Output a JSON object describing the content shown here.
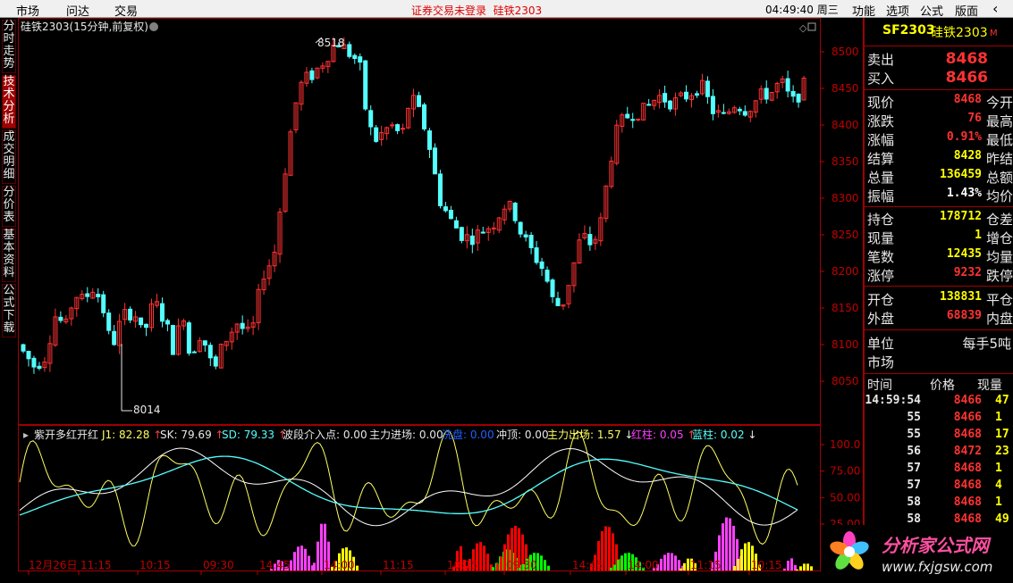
{
  "topbar": {
    "menus": [
      "市场",
      "问达",
      "交易"
    ],
    "notice": "证券交易未登录",
    "symbol": "硅铁2303",
    "time": "04:49:40",
    "weekday": "周三",
    "right_menus": [
      "功能",
      "选项",
      "公式",
      "版面"
    ],
    "back": "‹"
  },
  "left_tabs": [
    "分时走势",
    "技术分析",
    "成交明细",
    "分价表",
    "基本资料",
    "公式下载"
  ],
  "active_tab": 1,
  "chart": {
    "title": "硅铁2303(15分钟,前复权)",
    "price_axis": [
      "8500",
      "8450",
      "8400",
      "8350",
      "8300",
      "8250",
      "8200",
      "8150",
      "8100",
      "8050"
    ],
    "high_label": "8518",
    "low_label": "8014",
    "indicator_axis": [
      "100.0",
      "75.00",
      "50.00",
      "25.00"
    ],
    "time_axis": [
      "12月26日",
      "11:15",
      "10:15",
      "09:30",
      "14:45",
      "14:00",
      "11:15",
      "10:15",
      "09:30",
      "14:45",
      "14:00",
      "11:15",
      "10:15"
    ],
    "colors": {
      "up": "#ff3232",
      "down": "#54ffff",
      "bg": "#000000",
      "grid": "#800000",
      "axis": "#c00000"
    }
  },
  "indicator": {
    "name": "紫开多红开红",
    "j1": "J1: 82.28",
    "sk": "SK: 79.69",
    "sd": "SD: 79.33",
    "wave": "波段介入点: 0.00",
    "main_in": "主力进场: 0.00",
    "wash": "洗盘: 0.00",
    "top": "冲顶: 0.00",
    "main_out": "主力出场: 1.57",
    "red": "红柱: 0.05",
    "blue": "蓝柱: 0.02"
  },
  "quote": {
    "code": "SF2303",
    "name": "硅铁2303",
    "tag": "M",
    "sell_label": "卖出",
    "sell": "8468",
    "buy_label": "买入",
    "buy": "8466",
    "rows": [
      {
        "l": "现价",
        "v": "8468",
        "r": "今开",
        "c": "#ff3232"
      },
      {
        "l": "涨跌",
        "v": "76",
        "r": "最高",
        "c": "#ff3232"
      },
      {
        "l": "涨幅",
        "v": "0.91%",
        "r": "最低",
        "c": "#ff3232"
      },
      {
        "l": "结算",
        "v": "8428",
        "r": "昨结",
        "c": "#ffff00"
      },
      {
        "l": "总量",
        "v": "136459",
        "r": "总额",
        "c": "#ffff00"
      },
      {
        "l": "振幅",
        "v": "1.43%",
        "r": "均价",
        "c": "#ffffff"
      }
    ],
    "rows2": [
      {
        "l": "持仓",
        "v": "178712",
        "r": "仓差",
        "c": "#ffff00"
      },
      {
        "l": "现量",
        "v": "1",
        "r": "增仓",
        "c": "#ffff00"
      },
      {
        "l": "笔数",
        "v": "12435",
        "r": "均量",
        "c": "#ffff00"
      },
      {
        "l": "涨停",
        "v": "9232",
        "r": "跌停",
        "c": "#ff3232"
      }
    ],
    "rows3": [
      {
        "l": "开仓",
        "v": "138831",
        "r": "平仓",
        "c": "#ffff00"
      },
      {
        "l": "外盘",
        "v": "68839",
        "r": "内盘",
        "c": "#ff3232"
      }
    ],
    "unit_label": "单位",
    "unit_value": "每手5吨",
    "market_label": "市场",
    "ticks_header": [
      "时间",
      "价格",
      "现量"
    ],
    "ticks": [
      {
        "t": "14:59:54",
        "p": "8466",
        "q": "47"
      },
      {
        "t": "55",
        "p": "8466",
        "q": "1"
      },
      {
        "t": "55",
        "p": "8468",
        "q": "17"
      },
      {
        "t": "56",
        "p": "8472",
        "q": "23"
      },
      {
        "t": "57",
        "p": "8468",
        "q": "1"
      },
      {
        "t": "57",
        "p": "8468",
        "q": "4"
      },
      {
        "t": "58",
        "p": "8468",
        "q": "1"
      },
      {
        "t": "58",
        "p": "8468",
        "q": "49"
      }
    ]
  },
  "logo": {
    "text": "分析家公式网",
    "url": "www.fxjgsw.com"
  }
}
